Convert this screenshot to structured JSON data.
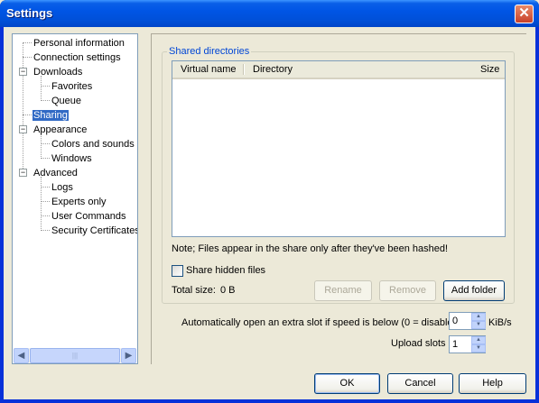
{
  "window": {
    "title": "Settings",
    "close_icon": "close-icon"
  },
  "tree": {
    "items": [
      {
        "label": "Personal information"
      },
      {
        "label": "Connection settings"
      },
      {
        "label": "Downloads",
        "expander": "−"
      },
      {
        "label": "Favorites"
      },
      {
        "label": "Queue"
      },
      {
        "label": "Sharing",
        "selected": true
      },
      {
        "label": "Appearance",
        "expander": "−"
      },
      {
        "label": "Colors and sounds"
      },
      {
        "label": "Windows"
      },
      {
        "label": "Advanced",
        "expander": "−"
      },
      {
        "label": "Logs"
      },
      {
        "label": "Experts only"
      },
      {
        "label": "User Commands"
      },
      {
        "label": "Security Certificates"
      }
    ],
    "scroll_left": "◀",
    "scroll_right": "▶",
    "thumb_grip": "|||"
  },
  "shared": {
    "group_title": "Shared directories",
    "columns": [
      "Virtual name",
      "Directory",
      "Size"
    ],
    "note": "Note; Files appear in the share only after they've been hashed!",
    "hidden_files_label": "Share hidden files",
    "hidden_files_checked": false,
    "total_label": "Total size:",
    "total_value": "0 B",
    "rename_label": "Rename",
    "remove_label": "Remove",
    "add_folder_label": "Add folder"
  },
  "slots": {
    "speed_label": "Automatically open an extra slot if speed is below (0 = disable)",
    "speed_value": "0",
    "speed_unit": "KiB/s",
    "upload_label": "Upload slots",
    "upload_value": "1",
    "spin_up": "▲",
    "spin_down": "▼"
  },
  "footer": {
    "ok_label": "OK",
    "cancel_label": "Cancel",
    "help_label": "Help"
  }
}
